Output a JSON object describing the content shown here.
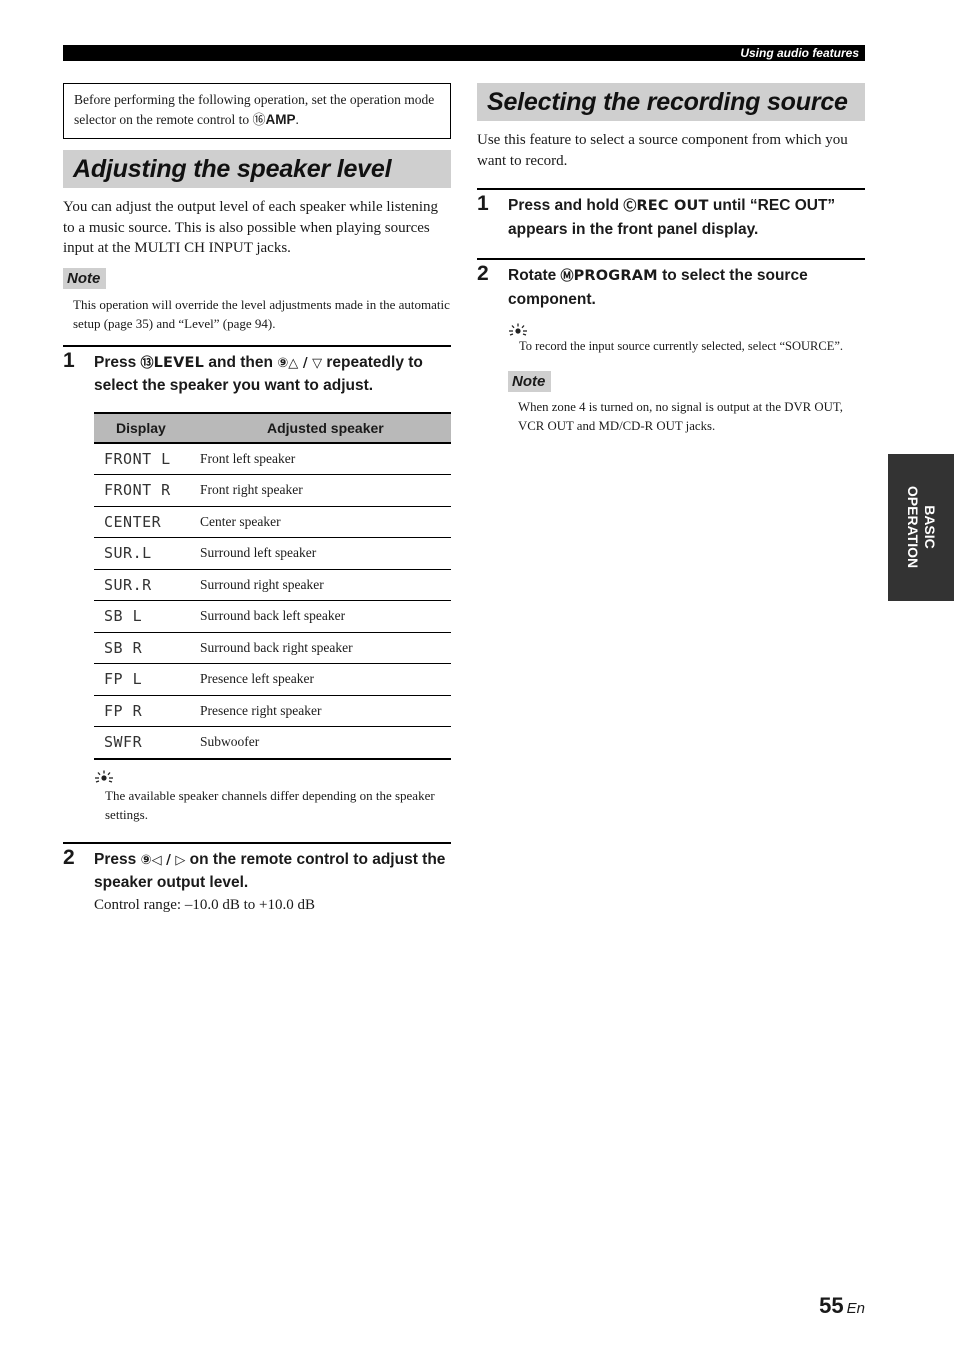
{
  "header": {
    "section_label": "Using audio features"
  },
  "left": {
    "prebox": {
      "text": "Before performing the following operation, set the operation mode selector on the remote control to ",
      "button_num": "⑯",
      "button_label": "AMP",
      "end": "."
    },
    "title": "Adjusting the speaker level",
    "intro": "You can adjust the output level of each speaker while listening to a music source. This is also possible when playing sources input at the MULTI CH INPUT jacks.",
    "note": {
      "label": "Note",
      "text": "This operation will override the level adjustments made in the automatic setup (page 35) and “Level” (page 94)."
    },
    "step1": {
      "num": "1",
      "pre": "Press ",
      "btn1_num": "⑬",
      "btn1_label": "LEVEL",
      "mid": " and then ",
      "btn2_num": "⑨",
      "arrows": "△ / ▽",
      "post": " repeatedly to select the speaker you want to adjust."
    },
    "table": {
      "headers": [
        "Display",
        "Adjusted speaker"
      ],
      "rows": [
        {
          "display": "FRONT L",
          "speaker": "Front left speaker"
        },
        {
          "display": "FRONT R",
          "speaker": "Front right speaker"
        },
        {
          "display": "CENTER",
          "speaker": "Center speaker"
        },
        {
          "display": "SUR.L",
          "speaker": "Surround left speaker"
        },
        {
          "display": "SUR.R",
          "speaker": "Surround right speaker"
        },
        {
          "display": "SB L",
          "speaker": "Surround back left speaker"
        },
        {
          "display": "SB R",
          "speaker": "Surround back right speaker"
        },
        {
          "display": "FP L",
          "speaker": "Presence left speaker"
        },
        {
          "display": "FP R",
          "speaker": "Presence right speaker"
        },
        {
          "display": "SWFR",
          "speaker": "Subwoofer"
        }
      ]
    },
    "tip": {
      "icon": "lightbulb-icon",
      "text": "The available speaker channels differ depending on the speaker settings."
    },
    "step2": {
      "num": "2",
      "pre": "Press ",
      "btn_num": "⑨",
      "arrows": "◁ / ▷",
      "post": " on the remote control to adjust the speaker output level.",
      "sub": "Control range: –10.0 dB to +10.0 dB"
    }
  },
  "right": {
    "title": "Selecting the recording source",
    "intro": "Use this feature to select a source component from which you want to record.",
    "step1": {
      "num": "1",
      "pre": "Press and hold ",
      "btn_num": "Ⓒ",
      "btn_label": "REC OUT",
      "post": " until “REC OUT” appears in the front panel display."
    },
    "step2": {
      "num": "2",
      "pre": "Rotate ",
      "btn_num": "Ⓜ",
      "btn_label": "PROGRAM",
      "post": " to select the source component."
    },
    "tip": {
      "icon": "lightbulb-icon",
      "text": "To record the input source currently selected, select “SOURCE”."
    },
    "note": {
      "label": "Note",
      "text": "When zone 4 is turned on, no signal is output at the DVR OUT, VCR OUT and MD/CD-R OUT jacks."
    }
  },
  "side_tab": {
    "line1": "BASIC",
    "line2": "OPERATION"
  },
  "footer": {
    "page": "55",
    "lang": "En"
  }
}
